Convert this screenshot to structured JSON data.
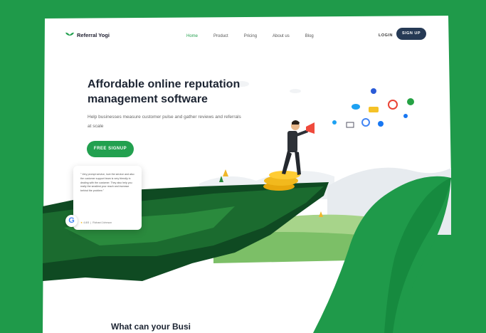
{
  "brand": {
    "name": "Referral Yogi"
  },
  "nav": {
    "items": [
      {
        "label": "Home",
        "active": true
      },
      {
        "label": "Product",
        "active": false
      },
      {
        "label": "Pricing",
        "active": false
      },
      {
        "label": "About us",
        "active": false
      },
      {
        "label": "Blog",
        "active": false
      }
    ],
    "login": "LOGIN",
    "signup": "SIGN UP"
  },
  "hero": {
    "title": "Affordable online reputation management software",
    "subtitle": "Help businesses measure customer pulse and gather reviews and referrals at scale",
    "cta": "FREE SIGNUP"
  },
  "review": {
    "text": "\" Very prompt service, love the service and also the customer support team is very friendly in dealing with the customer. They also help you really the smallest your reach and increase behind the problem \"",
    "rating": "4.8/5",
    "author": "Richard Johnson"
  },
  "section": {
    "heading_partial": "What can your Busi"
  },
  "colors": {
    "background": "#1f9a4a",
    "accent": "#22a04f",
    "navy": "#263a55"
  }
}
